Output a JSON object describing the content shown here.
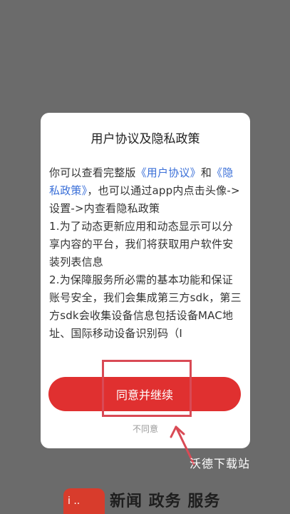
{
  "dialog": {
    "title": "用户协议及隐私政策",
    "body": {
      "intro_prefix": "你可以查看完整版",
      "user_agreement_link": "《用户协议》",
      "intro_and": "和",
      "privacy_policy_link": "《隐私政策》",
      "intro_suffix": "，也可以通过app内点击头像->设置->内查看隐私政策",
      "item1": "1.为了动态更新应用和动态显示可以分享内容的平台，我们将获取用户软件安装列表信息",
      "item2": "2.为保障服务所必需的基本功能和保证账号安全，我们会集成第三方sdk，第三方sdk会收集设备信息包括设备MAC地址、国际移动设备识别码（I"
    },
    "agree_label": "同意并继续",
    "disagree_label": "不同意"
  },
  "watermark": "沃德下载站",
  "bottom": {
    "logo_text": "i ..",
    "slogan": "新闻 政务 服务"
  },
  "colors": {
    "accent_red": "#e03030",
    "link_blue": "#3a6fd8",
    "annotation_red": "#d94a55"
  }
}
